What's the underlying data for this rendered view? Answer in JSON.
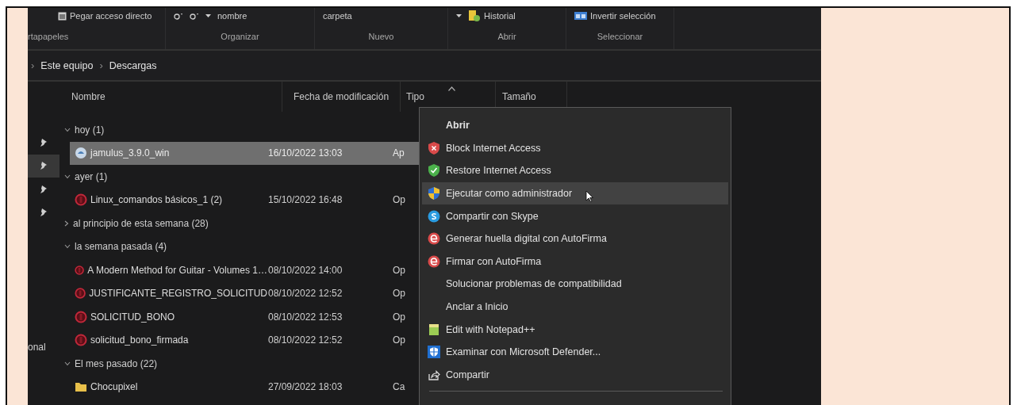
{
  "ribbon": {
    "groups": [
      {
        "label": "rtapapeles",
        "commands": [
          {
            "kind": "paste",
            "label": "Pegar acceso directo"
          }
        ]
      },
      {
        "label": "Organizar",
        "commands": [
          {
            "kind": "letter"
          },
          {
            "kind": "letter"
          },
          {
            "kind": "caret"
          },
          {
            "kind": "text",
            "label": "nombre"
          }
        ]
      },
      {
        "label": "Nuevo",
        "commands": [
          {
            "kind": "text",
            "label": "carpeta"
          }
        ]
      },
      {
        "label": "Abrir",
        "commands": [
          {
            "kind": "caret"
          },
          {
            "kind": "history",
            "label": "Historial"
          }
        ]
      },
      {
        "label": "Seleccionar",
        "commands": [
          {
            "kind": "invert",
            "label": "Invertir selección"
          }
        ]
      }
    ]
  },
  "address": [
    {
      "kind": "chevron",
      "label": "›"
    },
    {
      "kind": "crumb",
      "label": "Este equipo"
    },
    {
      "kind": "chevron",
      "label": "›"
    },
    {
      "kind": "crumb",
      "label": "Descargas"
    }
  ],
  "nav": {
    "pins": [
      {
        "selected": false
      },
      {
        "selected": true
      },
      {
        "selected": false
      },
      {
        "selected": false
      }
    ],
    "label": "onal"
  },
  "table": {
    "columns": [
      {
        "label": "Nombre",
        "sorted": false
      },
      {
        "label": "Fecha de modificación",
        "sorted": false
      },
      {
        "label": "Tipo",
        "sorted": true
      },
      {
        "label": "Tamaño",
        "sorted": false
      }
    ],
    "groups": [
      {
        "label": "hoy (1)",
        "expanded": true,
        "files": [
          {
            "kind": "app",
            "name": "jamulus_3.9.0_win",
            "date": "16/10/2022 13:03",
            "type": "Ap",
            "selected": true
          }
        ]
      },
      {
        "label": "ayer (1)",
        "expanded": true,
        "files": [
          {
            "kind": "pdf",
            "name": "Linux_comandos básicos_1 (2)",
            "date": "15/10/2022 16:48",
            "type": "Op",
            "selected": false
          }
        ]
      },
      {
        "label": "al principio de esta semana (28)",
        "expanded": false
      },
      {
        "label": "la semana pasada (4)",
        "expanded": true,
        "files": [
          {
            "kind": "pdf",
            "name": "A Modern Method for Guitar - Volumes 1…",
            "date": "08/10/2022 14:00",
            "type": "Op",
            "selected": false
          },
          {
            "kind": "pdf",
            "name": "JUSTIFICANTE_REGISTRO_SOLICITUD",
            "date": "08/10/2022 12:52",
            "type": "Op",
            "selected": false
          },
          {
            "kind": "pdf",
            "name": "SOLICITUD_BONO",
            "date": "08/10/2022 12:53",
            "type": "Op",
            "selected": false
          },
          {
            "kind": "pdf",
            "name": "solicitud_bono_firmada",
            "date": "08/10/2022 12:52",
            "type": "Op",
            "selected": false
          }
        ]
      },
      {
        "label": "El mes pasado (22)",
        "expanded": true,
        "files": [
          {
            "kind": "folder",
            "name": "Chocupixel",
            "date": "27/09/2022 18:03",
            "type": "Ca",
            "selected": false
          }
        ]
      }
    ]
  },
  "context_menu": {
    "items": [
      {
        "label": "Abrir",
        "kind": "none",
        "bold": true,
        "selected": false
      },
      {
        "label": "Block Internet Access",
        "kind": "shield-red",
        "bold": false,
        "selected": false
      },
      {
        "label": "Restore Internet Access",
        "kind": "shield-green",
        "bold": false,
        "selected": false
      },
      {
        "label": "Ejecutar como administrador",
        "kind": "uac",
        "bold": false,
        "selected": true
      },
      {
        "label": "Compartir con Skype",
        "kind": "skype",
        "bold": false,
        "selected": false
      },
      {
        "label": "Generar huella digital con AutoFirma",
        "kind": "autofirma",
        "bold": false,
        "selected": false
      },
      {
        "label": "Firmar con AutoFirma",
        "kind": "autofirma",
        "bold": false,
        "selected": false
      },
      {
        "label": "Solucionar problemas de compatibilidad",
        "kind": "none",
        "bold": false,
        "selected": false
      },
      {
        "label": "Anclar a Inicio",
        "kind": "none",
        "bold": false,
        "selected": false
      },
      {
        "label": "Edit with Notepad++",
        "kind": "notepad",
        "bold": false,
        "selected": false
      },
      {
        "label": "Examinar con Microsoft Defender...",
        "kind": "defender",
        "bold": false,
        "selected": false
      },
      {
        "label": "Compartir",
        "kind": "share",
        "bold": false,
        "selected": false
      }
    ]
  }
}
